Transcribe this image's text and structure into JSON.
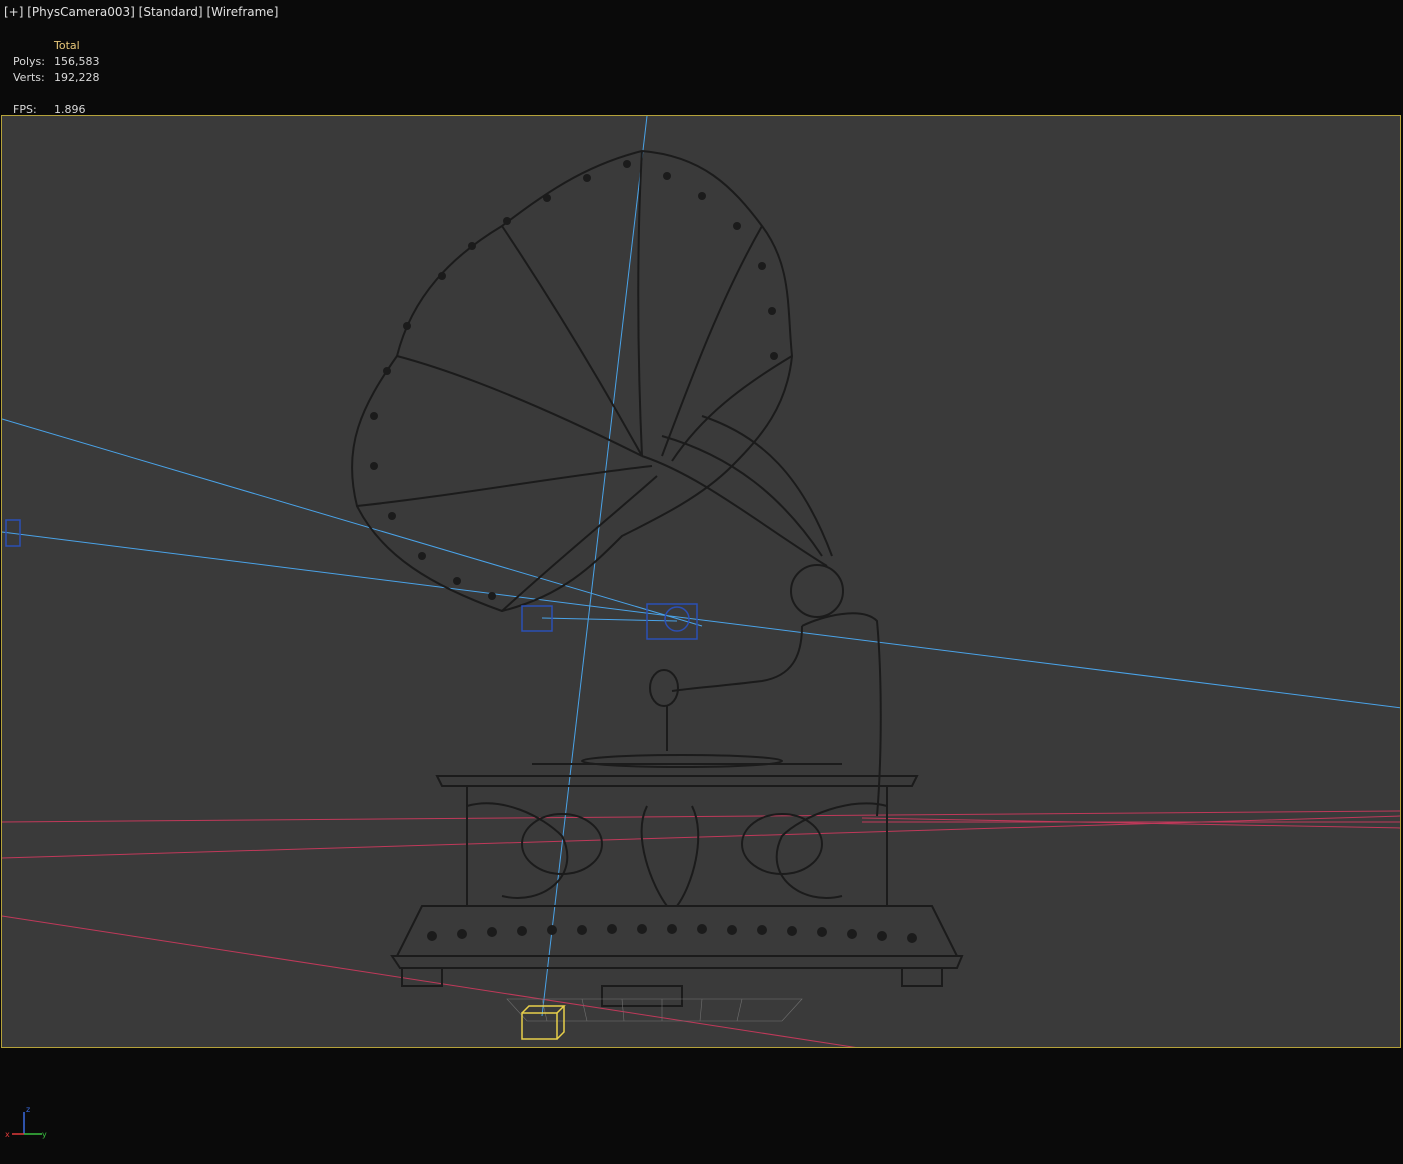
{
  "viewport": {
    "menu_label": "[+]",
    "camera_label": "[PhysCamera003]",
    "shading_label": "[Standard]",
    "display_label": "[Wireframe]"
  },
  "stats": {
    "header": "Total",
    "polys_label": "Polys:",
    "polys_value": "156,583",
    "verts_label": "Verts:",
    "verts_value": "192,228",
    "fps_label": "FPS:",
    "fps_value": "1.896"
  },
  "axis": {
    "x": "x",
    "y": "y",
    "z": "z"
  },
  "colors": {
    "background": "#0a0a0a",
    "viewport_bg": "#3a3a3a",
    "safe_frame": "#b5a23a",
    "camera_lines": "#4aa3e8",
    "grid_lines": "#c0395a",
    "wire": "#1a1a1a",
    "selection": "#e8d04a",
    "target": "#2b4fb5"
  },
  "scene": {
    "object": "gramophone-wireframe"
  }
}
